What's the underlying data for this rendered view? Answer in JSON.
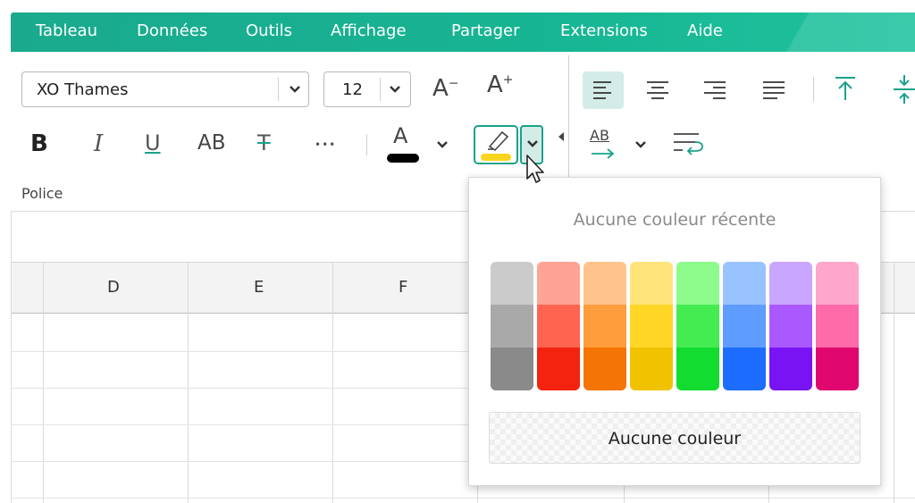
{
  "menu": [
    "Tableau",
    "Données",
    "Outils",
    "Affichage",
    "Partager",
    "Extensions",
    "Aide"
  ],
  "font": {
    "name": "XO Thames",
    "size": "12"
  },
  "format_buttons": {
    "bold": "B",
    "italic": "I",
    "underline": "U",
    "allcaps": "AB",
    "strike": "T",
    "more": "•••",
    "font_color_letter": "A",
    "text_dir": "AB"
  },
  "section_label": "Police",
  "columns": [
    "D",
    "E",
    "F"
  ],
  "highlight_popup": {
    "recent_label": "Aucune couleur récente",
    "no_color_label": "Aucune couleur",
    "palette": [
      [
        "#cbcbcb",
        "#a9a9a9",
        "#8a8a8a"
      ],
      [
        "#ffa396",
        "#ff6450",
        "#f4230f"
      ],
      [
        "#ffc48c",
        "#ff9d3c",
        "#f47404"
      ],
      [
        "#ffe47a",
        "#ffd626",
        "#f0c200"
      ],
      [
        "#8cfb8c",
        "#44ec52",
        "#11dc2f"
      ],
      [
        "#99c3ff",
        "#5e9cff",
        "#1b6cff"
      ],
      [
        "#c9a6ff",
        "#a959ff",
        "#7a13f4"
      ],
      [
        "#ffa6cc",
        "#ff6aa8",
        "#e0086f"
      ]
    ]
  },
  "colors": {
    "accent": "#18a28a",
    "highlight_yellow": "#f8d41c",
    "font_color_bar": "#000000"
  },
  "icons": [
    "font-decrease-icon",
    "font-increase-icon",
    "align-left-icon",
    "align-center-icon",
    "align-right-icon",
    "justify-icon",
    "align-top-icon",
    "align-middle-icon",
    "highlighter-icon",
    "wrap-text-icon"
  ]
}
